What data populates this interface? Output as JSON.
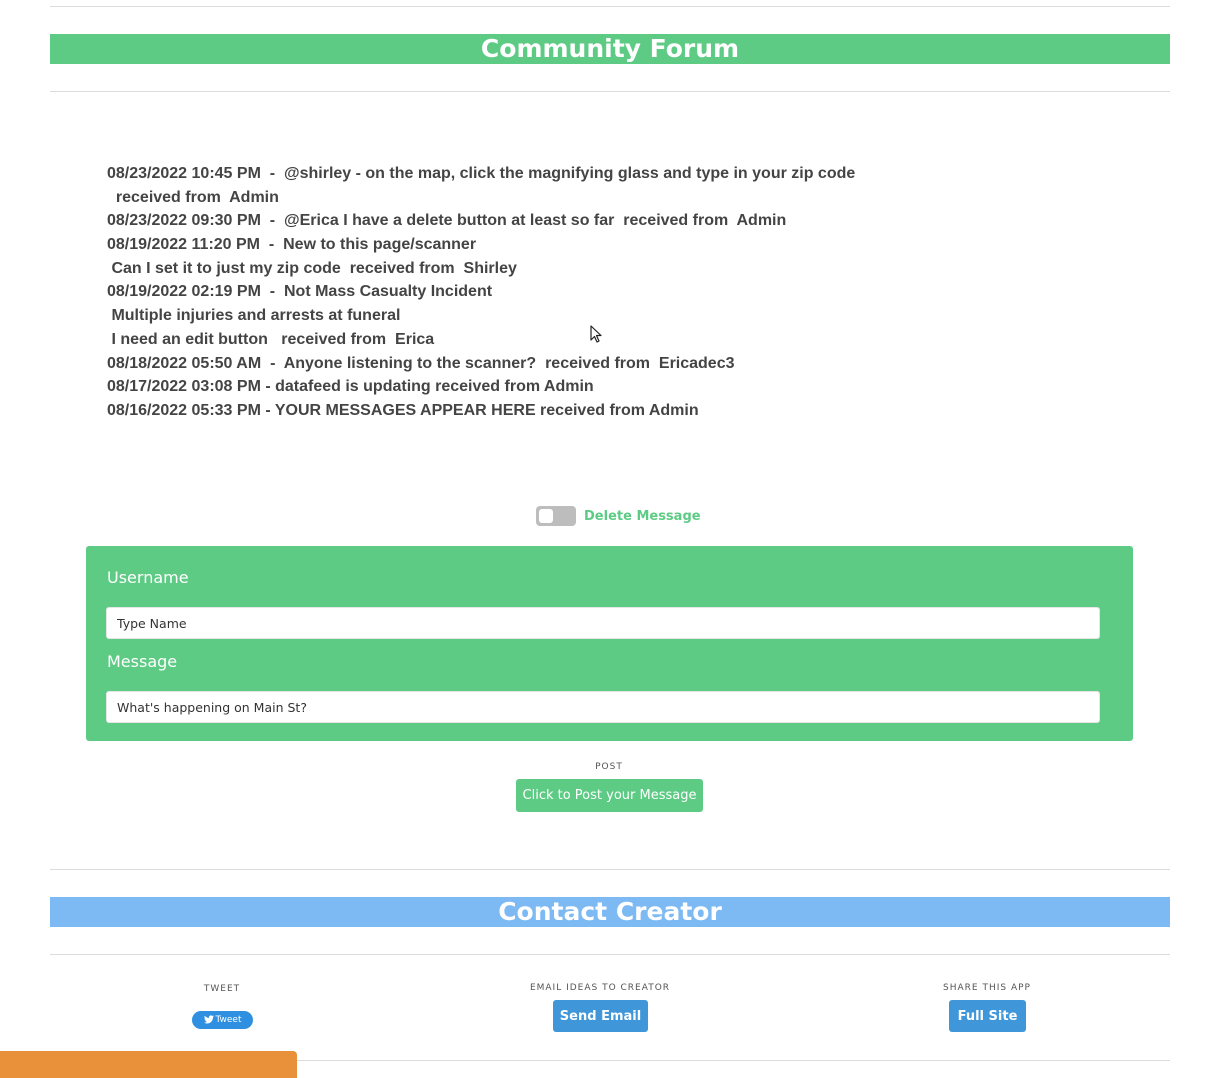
{
  "forum": {
    "title": "Community Forum",
    "messages": [
      "08/23/2022 10:45 PM  -  @shirley - on the map, click the magnifying glass and type in your zip code",
      "  received from  Admin",
      "08/23/2022 09:30 PM  -  @Erica I have a delete button at least so far  received from  Admin",
      "08/19/2022 11:20 PM  -  New to this page/scanner",
      " Can I set it to just my zip code  received from  Shirley",
      "08/19/2022 02:19 PM  -  Not Mass Casualty Incident",
      " Multiple injuries and arrests at funeral",
      " I need an edit button   received from  Erica",
      "08/18/2022 05:50 AM  -  Anyone listening to the scanner?  received from  Ericadec3",
      "08/17/2022 03:08 PM - datafeed is updating received from Admin",
      "08/16/2022 05:33 PM - YOUR MESSAGES APPEAR HERE received from Admin"
    ],
    "delete_toggle_label": "Delete Message",
    "username_label": "Username",
    "username_placeholder": "Type Name",
    "message_label": "Message",
    "message_placeholder": "What's happening on Main St?",
    "post_caption": "POST",
    "post_button": "Click to Post your Message"
  },
  "contact": {
    "title": "Contact Creator",
    "tweet_caption": "TWEET",
    "tweet_button": "Tweet",
    "email_caption": "EMAIL IDEAS TO CREATOR",
    "email_button": "Send Email",
    "share_caption": "SHARE THIS APP",
    "share_button": "Full Site"
  },
  "colors": {
    "accent_green": "#5ecb85",
    "accent_blue": "#7db9f3",
    "button_blue": "#3f97d9",
    "tab_orange": "#e8903a"
  },
  "icons": [
    "twitter-bird-icon",
    "mouse-pointer-icon"
  ]
}
